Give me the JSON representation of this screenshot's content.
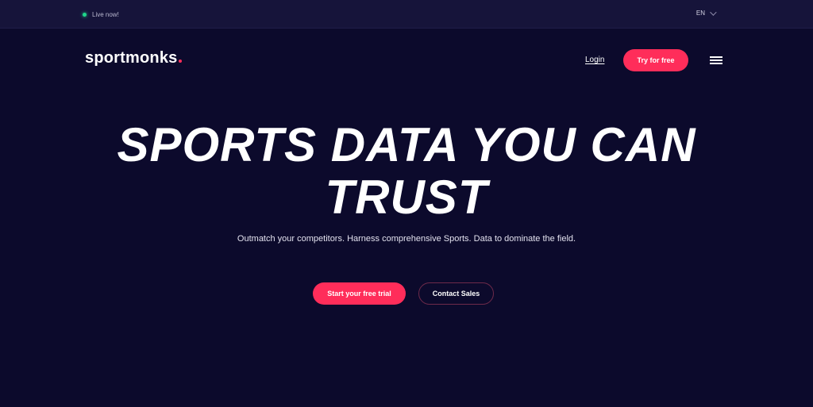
{
  "topbar": {
    "live_label": "Live now!",
    "language": "EN"
  },
  "nav": {
    "logo_text": "sportmonks",
    "login_label": "Login",
    "try_label": "Try for free"
  },
  "hero": {
    "title_line1": "SPORTS DATA YOU CAN",
    "title_line2": "TRUST",
    "subtitle": "Outmatch your competitors. Harness comprehensive Sports. Data to dominate the field.",
    "primary_cta": "Start your free trial",
    "secondary_cta": "Contact Sales"
  },
  "colors": {
    "background": "#0c0a2c",
    "topbar": "#16143a",
    "accent": "#ff2d5a",
    "live_indicator": "#1fd68a"
  },
  "icons": {
    "live": "live-dot-icon",
    "language_chevron": "chevron-down-icon",
    "menu": "hamburger-menu-icon"
  }
}
